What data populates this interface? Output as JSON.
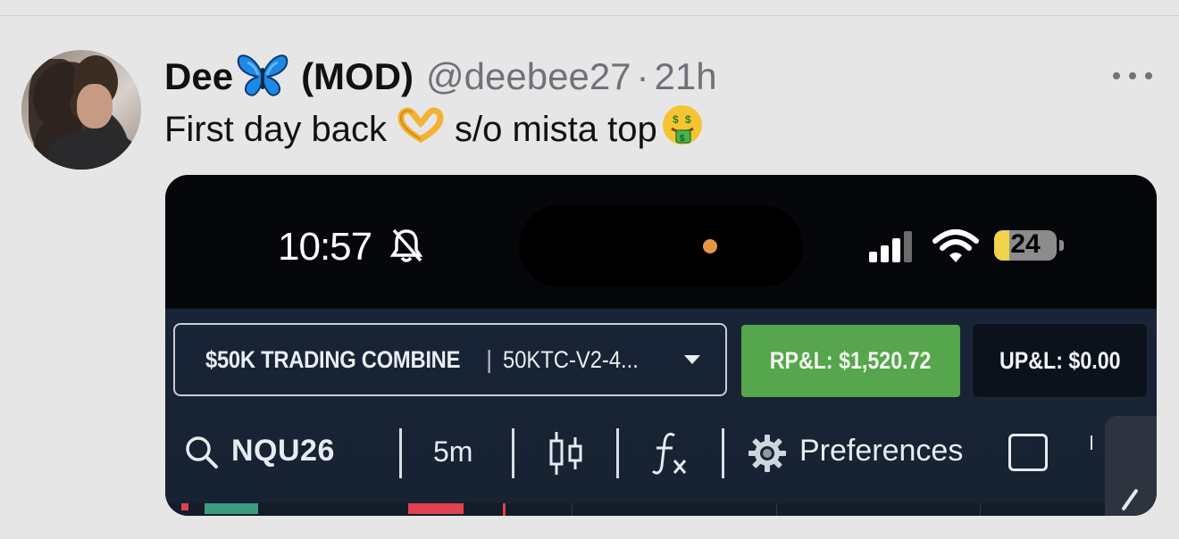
{
  "tweet": {
    "display_name": "Dee",
    "name_emoji": "butterfly-icon",
    "role": "(MOD)",
    "handle": "@deebee27",
    "separator": "·",
    "time": "21h",
    "text_part1": "First day back",
    "text_emoji1": "heart-hands-icon",
    "text_part2": "s/o mista top",
    "text_emoji2": "money-mouth-face-icon"
  },
  "phone_status": {
    "time": "10:57",
    "battery": "24",
    "battery_level_percent": 24
  },
  "trading_app": {
    "account_name": "$50K TRADING COMBINE",
    "account_separator": "|",
    "account_id": "50KTC-V2-4...",
    "realized_pnl": "RP&L: $1,520.72",
    "unrealized_pnl": "UP&L: $0.00",
    "symbol": "NQU26",
    "interval": "5m",
    "preferences": "Preferences"
  },
  "colors": {
    "accent_green": "#55a64c",
    "app_bg": "#182536",
    "camera_dot": "#e89346"
  }
}
